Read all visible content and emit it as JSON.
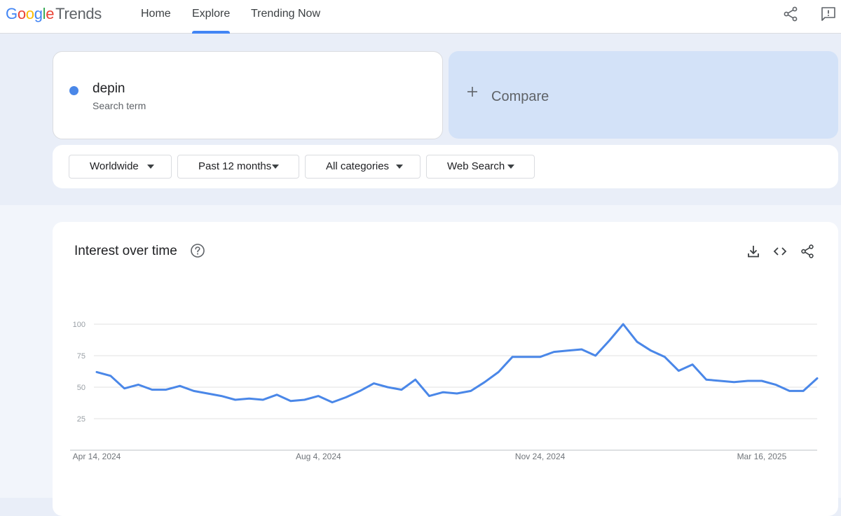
{
  "header": {
    "logo_google_letters": [
      "G",
      "o",
      "o",
      "g",
      "l",
      "e"
    ],
    "logo_google_colors": [
      "#4285f4",
      "#ea4335",
      "#fbbc05",
      "#4285f4",
      "#34a853",
      "#ea4335"
    ],
    "logo_product": "Trends",
    "nav": [
      {
        "label": "Home",
        "active": false
      },
      {
        "label": "Explore",
        "active": true
      },
      {
        "label": "Trending Now",
        "active": false
      }
    ],
    "icons": [
      "share-icon",
      "feedback-icon"
    ]
  },
  "search": {
    "term": "depin",
    "term_sub": "Search term",
    "term_color": "#4a87e8",
    "compare_label": "Compare",
    "compare_icon": "plus-icon"
  },
  "filters": [
    {
      "label": "Worldwide"
    },
    {
      "label": "Past 12 months"
    },
    {
      "label": "All categories"
    },
    {
      "label": "Web Search"
    }
  ],
  "chart_section": {
    "title": "Interest over time",
    "icons": [
      "help-icon",
      "download-icon",
      "embed-icon",
      "share-icon"
    ]
  },
  "chart_data": {
    "type": "line",
    "title": "Interest over time",
    "xlabel": "",
    "ylabel": "",
    "ylim": [
      0,
      100
    ],
    "y_ticks": [
      25,
      50,
      75,
      100
    ],
    "x_tick_labels": [
      "Apr 14, 2024",
      "Aug 4, 2024",
      "Nov 24, 2024",
      "Mar 16, 2025"
    ],
    "x_tick_index": [
      0,
      16,
      32,
      48
    ],
    "grid": true,
    "line_color": "#4a87e8",
    "series": [
      {
        "values": [
          62,
          59,
          49,
          52,
          48,
          48,
          51,
          47,
          45,
          43,
          40,
          41,
          40,
          44,
          39,
          40,
          43,
          38,
          42,
          47,
          53,
          50,
          48,
          56,
          43,
          46,
          45,
          47,
          54,
          62,
          74,
          74,
          74,
          78,
          79,
          80,
          75,
          87,
          100,
          86,
          79,
          74,
          63,
          68,
          56,
          55,
          54,
          55,
          55,
          52,
          47,
          47,
          57
        ]
      }
    ]
  }
}
